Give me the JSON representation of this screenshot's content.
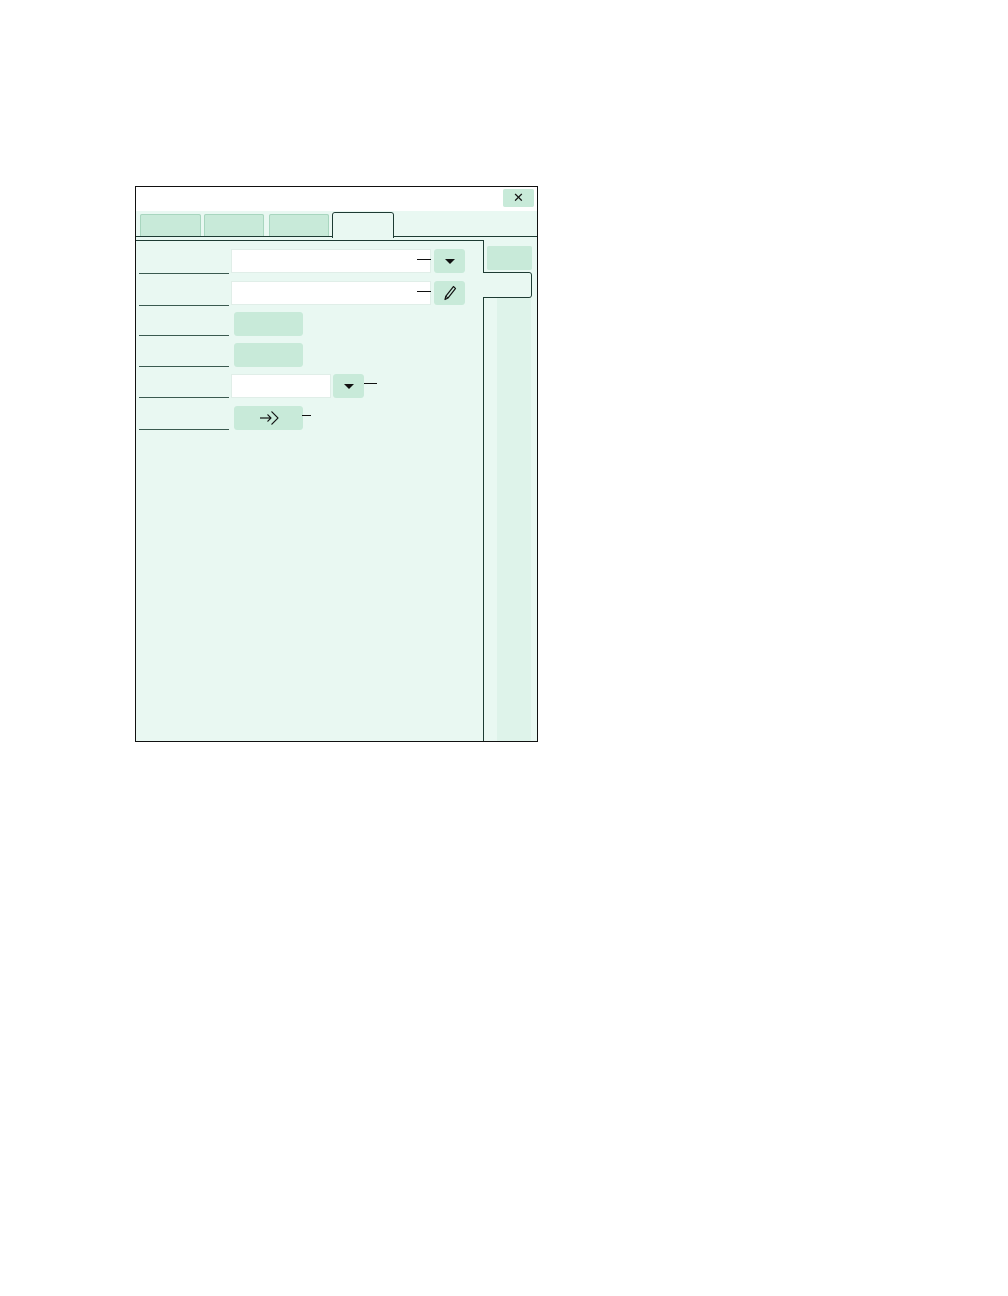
{
  "window": {
    "title": "",
    "close_icon": "close-icon",
    "close_glyph": "✕"
  },
  "tabs": [
    {
      "label": ""
    },
    {
      "label": ""
    },
    {
      "label": ""
    },
    {
      "label": "",
      "active": true
    }
  ],
  "side_tabs": [
    {
      "label": ""
    },
    {
      "label": "",
      "active": true
    }
  ],
  "form": {
    "rows": [
      {
        "label": "",
        "control": "dropdown",
        "value": "",
        "icon": "chevron-down-icon"
      },
      {
        "label": "",
        "control": "text-edit",
        "value": "",
        "icon": "pencil-icon"
      },
      {
        "label": "",
        "control": "button",
        "button_label": ""
      },
      {
        "label": "",
        "control": "button",
        "button_label": ""
      },
      {
        "label": "",
        "control": "dropdown",
        "value": "",
        "icon": "chevron-down-icon"
      },
      {
        "label": "",
        "control": "icon-button",
        "icon": "enter-arrow-icon"
      }
    ]
  },
  "colors": {
    "panel": "#e9f8f2",
    "control": "#c8ead9",
    "frame": "#1d3b33"
  }
}
